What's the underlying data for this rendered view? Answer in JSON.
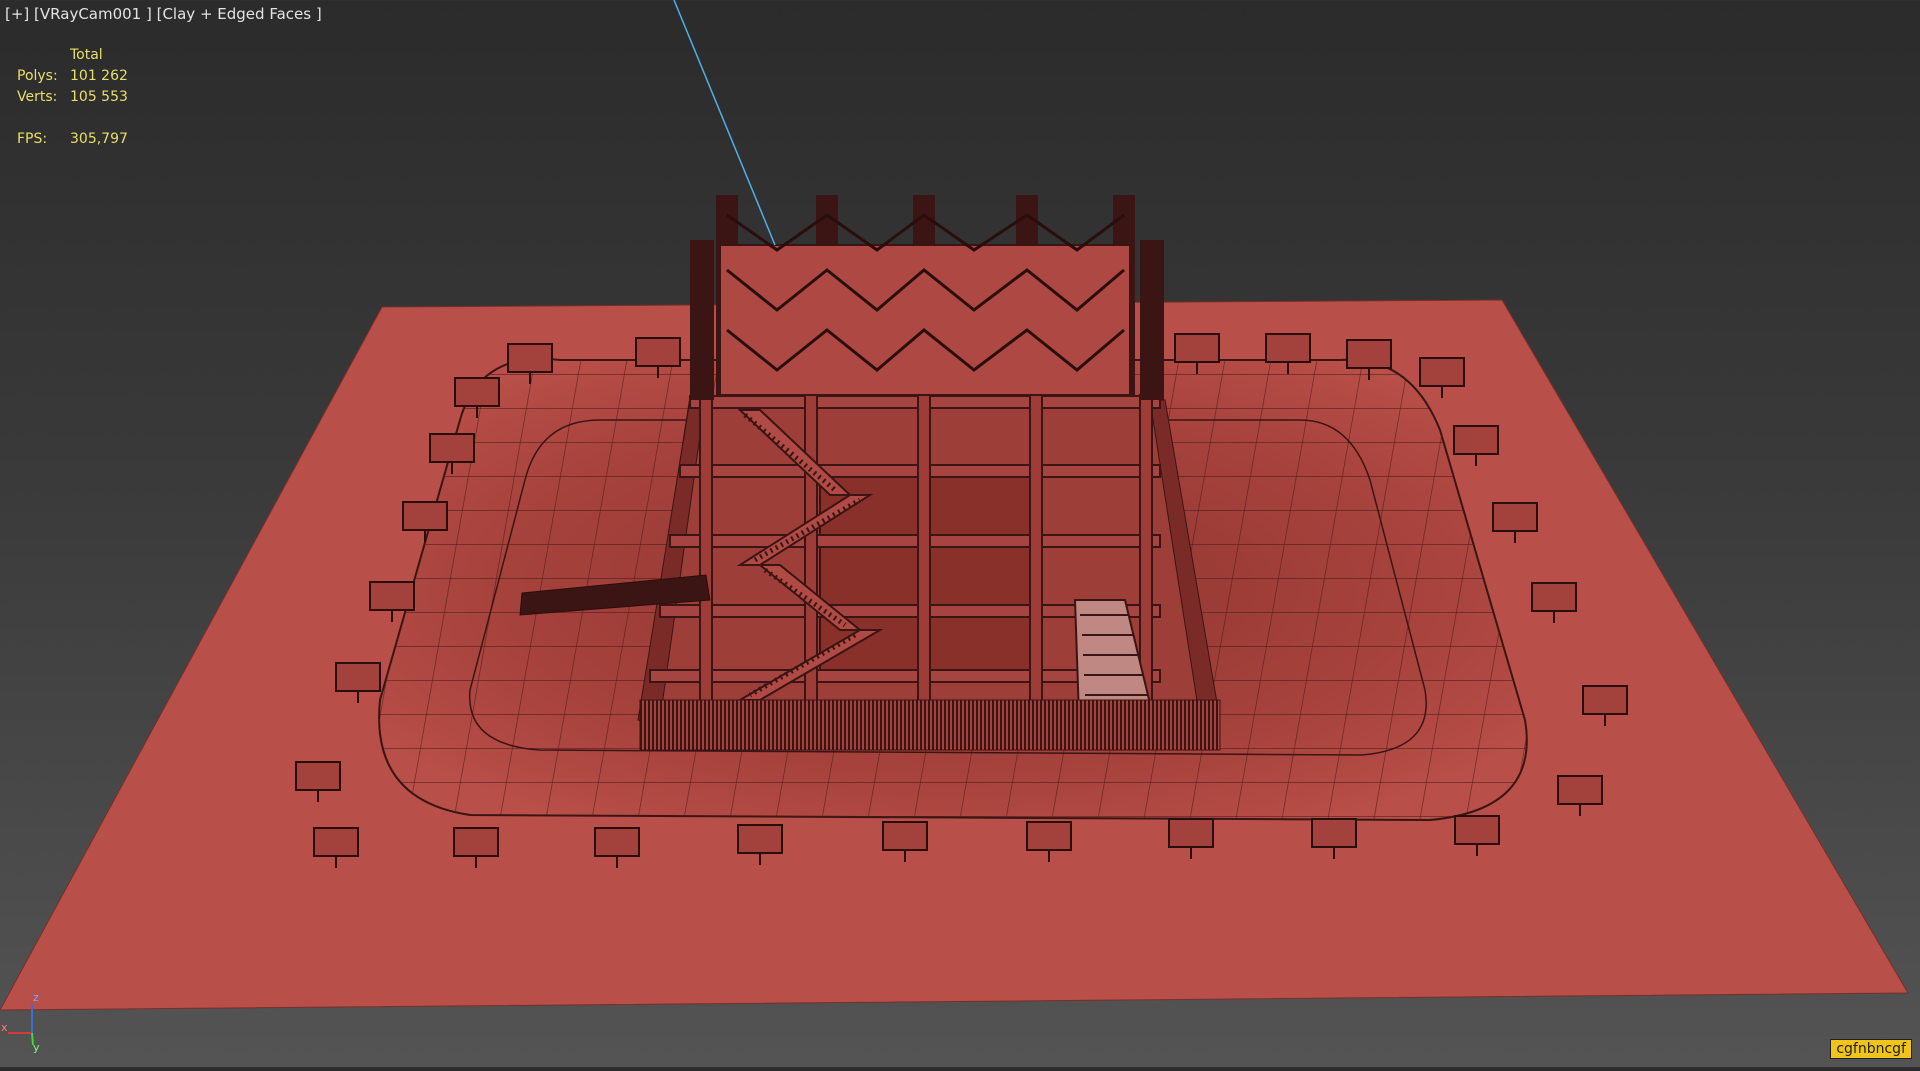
{
  "viewport": {
    "label": "[+] [VRayCam001 ] [Clay + Edged Faces ]"
  },
  "stats": {
    "header": "Total",
    "polys_label": "Polys:",
    "polys_value": "101 262",
    "verts_label": "Verts:",
    "verts_value": "105 553",
    "fps_label": "FPS:",
    "fps_value": "305,797"
  },
  "gizmo": {
    "z": "z",
    "x": "x",
    "y": "y"
  },
  "badge": {
    "text": "cgfnbncgf"
  },
  "colors": {
    "clay": "#b84f48",
    "edge": "#3b1513",
    "pit": "#9a3c36",
    "camera_line": "#4fb0e6",
    "stats_text": "#e9df6a",
    "badge_bg": "#f0c419"
  },
  "icons": [
    "viewport-axis-gizmo-icon",
    "camera-target-line"
  ]
}
